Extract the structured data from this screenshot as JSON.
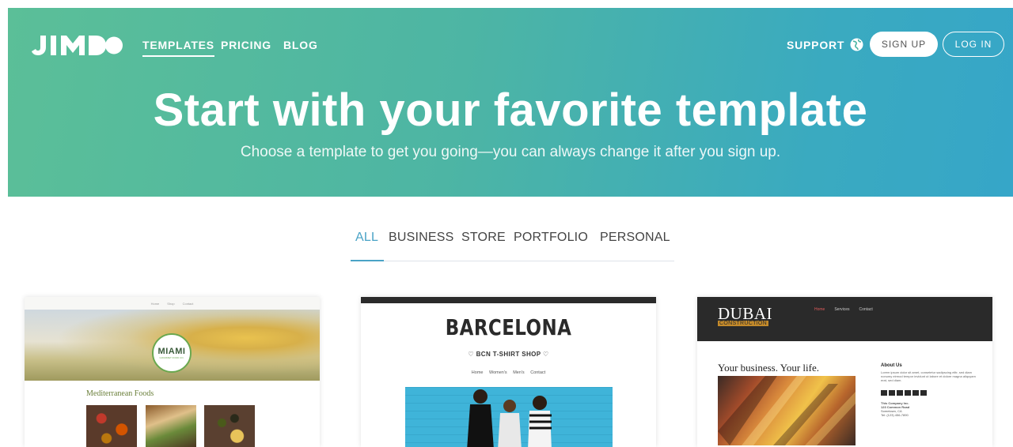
{
  "header": {
    "logo": "JIMDO",
    "nav": [
      {
        "label": "TEMPLATES",
        "active": true
      },
      {
        "label": "PRICING",
        "active": false
      },
      {
        "label": "BLOG",
        "active": false
      }
    ],
    "support_label": "SUPPORT",
    "signup_label": "SIGN UP",
    "login_label": "LOG IN"
  },
  "hero": {
    "title": "Start with your favorite template",
    "subtitle": "Choose a template to get you going—you can always change it after you sign up."
  },
  "filters": [
    {
      "label": "ALL",
      "active": true
    },
    {
      "label": "BUSINESS",
      "active": false
    },
    {
      "label": "STORE",
      "active": false
    },
    {
      "label": "PORTFOLIO",
      "active": false
    },
    {
      "label": "PERSONAL",
      "active": false
    }
  ],
  "templates": {
    "miami": {
      "nav": [
        "Home",
        "Shop",
        "Contact"
      ],
      "logo": "MIAMI",
      "logo_sub": "GOURMET FOOD CO.",
      "heading": "Mediterranean Foods"
    },
    "barcelona": {
      "title": "BARCELONA",
      "subtitle": "♡ BCN T-SHIRT SHOP ♡",
      "nav": [
        "Home",
        "Women's",
        "Men's",
        "Contact"
      ]
    },
    "dubai": {
      "title": "DUBAI",
      "tag": "CONSTRUCTION",
      "nav": [
        "Home",
        "Services",
        "Contact"
      ],
      "headline": "Your business. Your life.",
      "about_heading": "About Us",
      "about_text": "Lorem ipsum dolor sit amet, consetetur sadipscing elitr, sed diam nonumy eirmod tempor invidunt ut labore et dolore magna aliquyam erat, sed diam.",
      "address": [
        "This Company Inc.",
        "123 Common Road",
        "Sometown, CA",
        "Tel: (123) 456-7890"
      ]
    }
  },
  "colors": {
    "hero_start": "#5bbf98",
    "hero_end": "#36a6c8",
    "filter_active": "#4aa3c6"
  }
}
